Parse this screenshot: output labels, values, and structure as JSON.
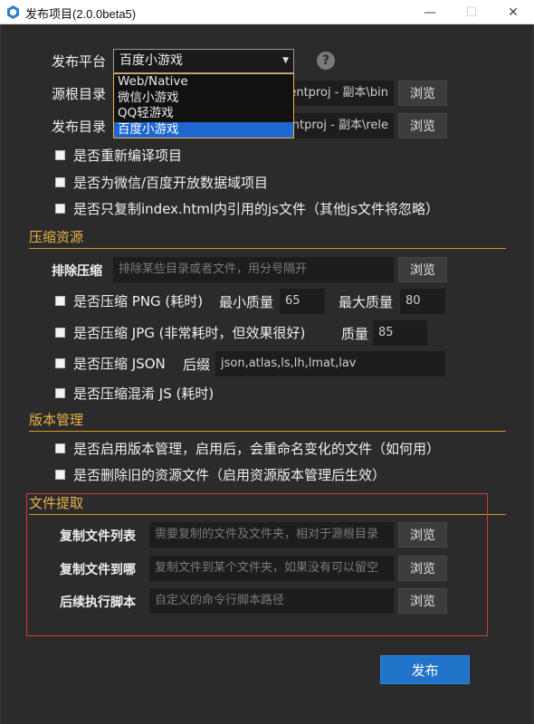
{
  "window": {
    "title": "发布项目(2.0.0beta5)",
    "minimize": "—",
    "maximize": "☐",
    "close": "✕"
  },
  "platform": {
    "label": "发布平台",
    "selected": "百度小游戏",
    "options": [
      "Web/Native",
      "微信小游戏",
      "QQ轻游戏",
      "百度小游戏"
    ],
    "help": "?"
  },
  "source_dir": {
    "label": "源根目录",
    "value": "entproj - 副本\\bin",
    "browse": "浏览"
  },
  "output_dir": {
    "label": "发布目录",
    "value": "entproj - 副本\\rele",
    "browse": "浏览"
  },
  "options": [
    "是否重新编译项目",
    "是否为微信/百度开放数据域项目",
    "是否只复制index.html内引用的js文件（其他js文件将忽略）"
  ],
  "compress": {
    "section_title": "压缩资源",
    "exclude_label": "排除压缩",
    "exclude_placeholder": "排除某些目录或者文件，用分号隔开",
    "browse": "浏览",
    "png_label": "是否压缩 PNG (耗时)",
    "png_min_label": "最小质量",
    "png_min_value": "65",
    "png_max_label": "最大质量",
    "png_max_value": "80",
    "jpg_label": "是否压缩 JPG (非常耗时，但效果很好)",
    "jpg_quality_label": "质量",
    "jpg_quality_value": "85",
    "json_label": "是否压缩 JSON",
    "json_suffix_label": "后缀",
    "json_suffix_value": "json,atlas,ls,lh,lmat,lav",
    "js_label": "是否压缩混淆 JS (耗时)"
  },
  "version": {
    "section_title": "版本管理",
    "enable_label": "是否启用版本管理，启用后，会重命名变化的文件（如何用）",
    "delete_label": "是否删除旧的资源文件（启用资源版本管理后生效）"
  },
  "extract": {
    "section_title": "文件提取",
    "copy_list_label": "复制文件列表",
    "copy_list_placeholder": "需要复制的文件及文件夹，相对于源根目录",
    "copy_to_label": "复制文件到哪",
    "copy_to_placeholder": "复制文件到某个文件夹，如果没有可以留空",
    "script_label": "后续执行脚本",
    "script_placeholder": "自定义的命令行脚本路径",
    "browse": "浏览"
  },
  "publish_button": "发布",
  "colors": {
    "accent": "#e6b248",
    "publish": "#1f73c9",
    "highlight_box": "#d43a3a",
    "selected_option": "#1e66d0"
  }
}
